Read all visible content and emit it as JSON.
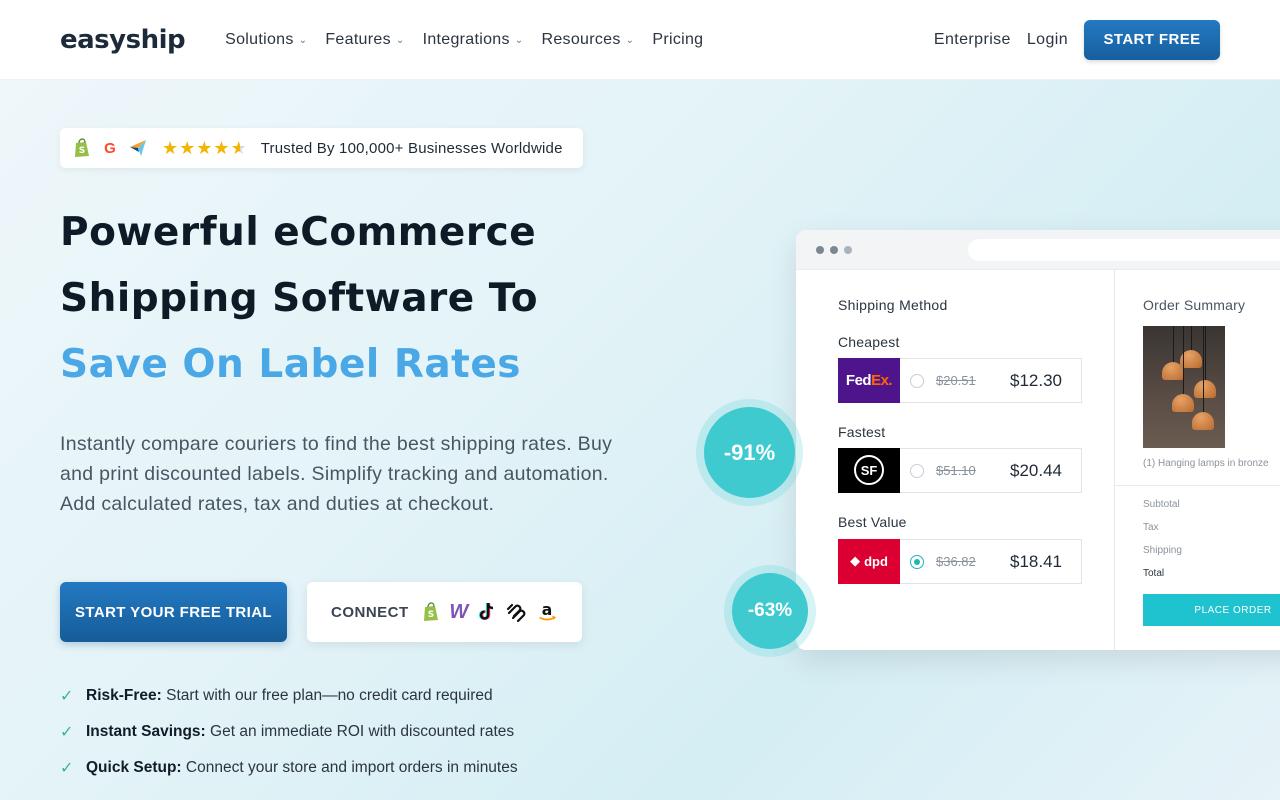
{
  "nav": {
    "logo": "easyship",
    "menu": [
      {
        "label": "Solutions"
      },
      {
        "label": "Features"
      },
      {
        "label": "Integrations"
      },
      {
        "label": "Resources"
      },
      {
        "label": "Pricing"
      }
    ],
    "enterprise": "Enterprise",
    "login": "Login",
    "cta": "START FREE"
  },
  "hero": {
    "trust_text": "Trusted By 100,000+ Businesses Worldwide",
    "rating_stars": 4.5,
    "headline_line1": "Powerful eCommerce",
    "headline_line2": "Shipping Software To",
    "headline_accent": "Save On Label Rates",
    "subtext": "Instantly compare couriers to find the best shipping rates. Buy and print discounted labels. Simplify tracking and automation. Add calculated rates, tax and duties at checkout.",
    "primary_cta": "START YOUR FREE TRIAL",
    "connect_label": "CONNECT",
    "benefits": [
      {
        "title": "Risk-Free:",
        "text": "Start with our free plan—no credit card required"
      },
      {
        "title": "Instant Savings:",
        "text": "Get an immediate ROI with discounted rates"
      },
      {
        "title": "Quick Setup:",
        "text": "Connect your store and import orders in minutes"
      }
    ],
    "colors": {
      "accent": "#4aa8e6",
      "primary": "#1d6fb3",
      "teal": "#3fcad0"
    }
  },
  "mock": {
    "shipping_method": "Shipping Method",
    "options": [
      {
        "label": "Cheapest",
        "carrier": "FedEx",
        "carrier_a": "Fed",
        "carrier_b": "Ex.",
        "old_price": "$20.51",
        "price": "$12.30"
      },
      {
        "label": "Fastest",
        "carrier": "SF",
        "carrier_a": "SF",
        "old_price": "$51.10",
        "price": "$20.44"
      },
      {
        "label": "Best Value",
        "carrier": "dpd",
        "carrier_a": "dpd",
        "old_price": "$36.82",
        "price": "$18.41"
      }
    ],
    "order_summary": "Order Summary",
    "item_caption": "(1) Hanging lamps in bronze",
    "subtotal": "Subtotal",
    "tax": "Tax",
    "shipping": "Shipping",
    "total": "Total",
    "place_order": "PLACE ORDER",
    "badge1": "-91%",
    "badge2": "-63%"
  }
}
